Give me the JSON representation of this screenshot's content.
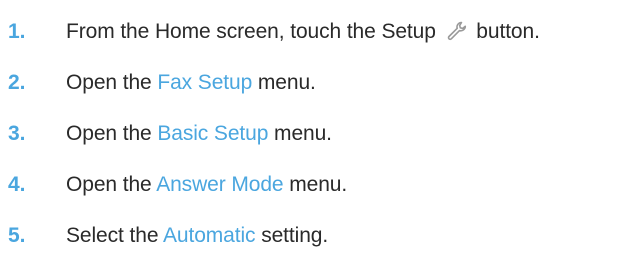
{
  "accent_color": "#4aa6df",
  "text_color": "#2a2a2a",
  "steps": [
    {
      "number": "1.",
      "before": "From the Home screen, touch the Setup ",
      "icon": "wrench-icon",
      "after": " button."
    },
    {
      "number": "2.",
      "before": "Open the ",
      "menu": "Fax Setup",
      "after": " menu."
    },
    {
      "number": "3.",
      "before": "Open the ",
      "menu": "Basic Setup",
      "after": " menu."
    },
    {
      "number": "4.",
      "before": "Open the ",
      "menu": "Answer Mode",
      "after": " menu."
    },
    {
      "number": "5.",
      "before": "Select the ",
      "menu": "Automatic",
      "after": " setting."
    }
  ]
}
